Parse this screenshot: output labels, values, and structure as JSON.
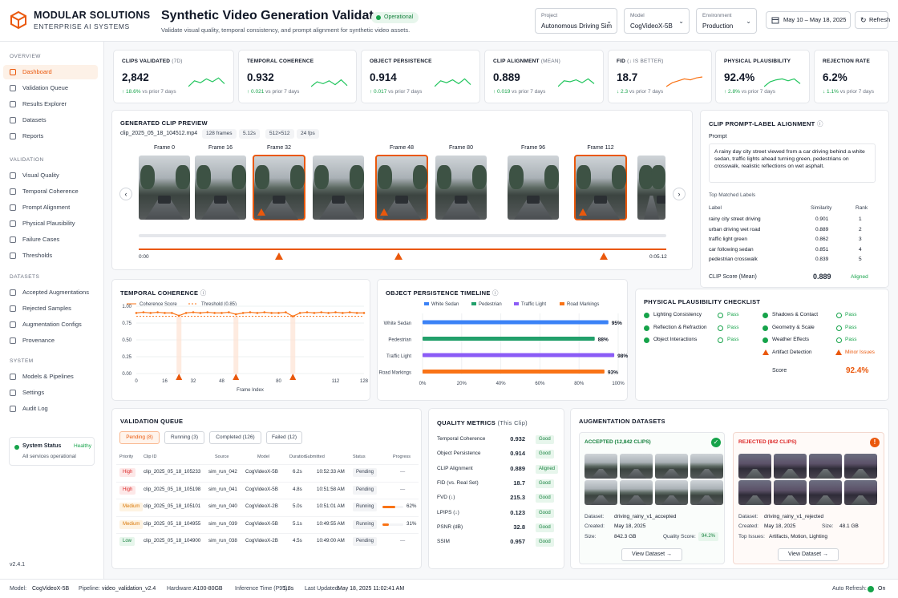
{
  "brand": {
    "name": "MODULAR SOLUTIONS",
    "tagline": "ENTERPRISE AI SYSTEMS"
  },
  "page": {
    "title": "Synthetic Video Generation Validator",
    "subtitle": "Validate visual quality, temporal consistency, and prompt alignment for synthetic video assets.",
    "status": "Operational"
  },
  "filters": {
    "project": {
      "label": "Project",
      "value": "Autonomous Driving Sim"
    },
    "model": {
      "label": "Model",
      "value": "CogVideoX-5B"
    },
    "environment": {
      "label": "Environment",
      "value": "Production"
    },
    "date_range": "May 10 – May 18, 2025",
    "refresh": "Refresh"
  },
  "sidebar": {
    "sections": [
      "OVERVIEW",
      "VALIDATION",
      "DATASETS",
      "SYSTEM"
    ],
    "overview": [
      "Dashboard",
      "Validation Queue",
      "Results Explorer",
      "Datasets",
      "Reports"
    ],
    "validation": [
      "Visual Quality",
      "Temporal Coherence",
      "Prompt Alignment",
      "Physical Plausibility",
      "Failure Cases",
      "Thresholds"
    ],
    "datasets": [
      "Accepted Augmentations",
      "Rejected Samples",
      "Augmentation Configs",
      "Provenance"
    ],
    "system": [
      "Models & Pipelines",
      "Settings",
      "Audit Log"
    ],
    "status": {
      "label": "System Status",
      "value": "Healthy",
      "detail": "All services operational"
    },
    "version": "v2.4.1"
  },
  "kpis": [
    {
      "label": "CLIPS VALIDATED",
      "sub": "(7D)",
      "value": "2,842",
      "delta": "↑ 18.6%",
      "note": "vs prior 7 days"
    },
    {
      "label": "TEMPORAL COHERENCE",
      "sub": "",
      "value": "0.932",
      "delta": "↑ 0.021",
      "note": "vs prior 7 days"
    },
    {
      "label": "OBJECT PERSISTENCE",
      "sub": "",
      "value": "0.914",
      "delta": "↑ 0.017",
      "note": "vs prior 7 days"
    },
    {
      "label": "CLIP ALIGNMENT",
      "sub": "(MEAN)",
      "value": "0.889",
      "delta": "↑ 0.019",
      "note": "vs prior 7 days"
    },
    {
      "label": "FID",
      "sub": "(↓ IS BETTER)",
      "value": "18.7",
      "delta": "↓ 2.3",
      "note": "vs prior 7 days"
    },
    {
      "label": "PHYSICAL PLAUSIBILITY",
      "sub": "",
      "value": "92.4%",
      "delta": "↑ 2.8%",
      "note": "vs prior 7 days"
    },
    {
      "label": "REJECTION RATE",
      "sub": "",
      "value": "6.2%",
      "delta": "↓ 1.1%",
      "note": "vs prior 7 days"
    }
  ],
  "preview": {
    "title": "GENERATED CLIP PREVIEW",
    "file": "clip_2025_05_18_104512.mp4",
    "tags": [
      "128 frames",
      "5.12s",
      "512×512",
      "24 fps"
    ],
    "frames": [
      "Frame 0",
      "Frame 16",
      "Frame 32",
      "",
      "Frame 48",
      "Frame 80",
      "Frame 96",
      "Frame 112"
    ],
    "start": "0:00",
    "end": "0:05.12"
  },
  "clip_align": {
    "title": "CLIP PROMPT-LABEL ALIGNMENT",
    "prompt_label": "Prompt",
    "prompt": "A rainy day city street viewed from a car driving behind a white sedan, traffic lights ahead turning green, pedestrians on crosswalk, realistic reflections on wet asphalt.",
    "top_label": "Top Matched Labels",
    "cols": [
      "Label",
      "Similarity",
      "Rank"
    ],
    "rows": [
      [
        "rainy city street driving",
        "0.901",
        "1"
      ],
      [
        "urban driving wet road",
        "0.889",
        "2"
      ],
      [
        "traffic light green",
        "0.862",
        "3"
      ],
      [
        "car following sedan",
        "0.851",
        "4"
      ],
      [
        "pedestrian crosswalk",
        "0.839",
        "5"
      ]
    ],
    "score_label": "CLIP Score (Mean)",
    "score": "0.889",
    "verdict": "Aligned"
  },
  "temporal": {
    "title": "TEMPORAL COHERENCE",
    "legend": [
      "Coherence Score",
      "Threshold (0.85)"
    ],
    "xlabel": "Frame Index"
  },
  "persistence": {
    "title": "OBJECT PERSISTENCE TIMELINE",
    "legend": [
      "White Sedan",
      "Pedestrian",
      "Traffic Light",
      "Road Markings"
    ]
  },
  "physical": {
    "title": "PHYSICAL PLAUSIBILITY CHECKLIST",
    "left": [
      [
        "Lighting Consistency",
        "Pass"
      ],
      [
        "Reflection & Refraction",
        "Pass"
      ],
      [
        "Object Interactions",
        "Pass"
      ]
    ],
    "right": [
      [
        "Shadows & Contact",
        "Pass"
      ],
      [
        "Geometry & Scale",
        "Pass"
      ],
      [
        "Weather Effects",
        "Pass"
      ],
      [
        "Artifact Detection",
        "Minor Issues"
      ]
    ],
    "score_label": "Score",
    "score": "92.4%"
  },
  "queue": {
    "title": "VALIDATION QUEUE",
    "tabs": [
      "Pending (8)",
      "Running (3)",
      "Completed (126)",
      "Failed (12)"
    ],
    "cols": [
      "Priority",
      "Clip ID",
      "Source",
      "Model",
      "Duration",
      "Submitted",
      "Status",
      "Progress"
    ],
    "rows": [
      [
        "High",
        "clip_2025_05_18_105233",
        "sim_run_042",
        "CogVideoX-5B",
        "6.2s",
        "10:52:33 AM",
        "Pending",
        "—"
      ],
      [
        "High",
        "clip_2025_05_18_105198",
        "sim_run_041",
        "CogVideoX-5B",
        "4.8s",
        "10:51:58 AM",
        "Pending",
        "—"
      ],
      [
        "Medium",
        "clip_2025_05_18_105101",
        "sim_run_040",
        "CogVideoX-2B",
        "5.0s",
        "10:51:01 AM",
        "Running",
        "62%"
      ],
      [
        "Medium",
        "clip_2025_05_18_104955",
        "sim_run_039",
        "CogVideoX-5B",
        "5.1s",
        "10:49:55 AM",
        "Running",
        "31%"
      ],
      [
        "Low",
        "clip_2025_05_18_104900",
        "sim_run_038",
        "CogVideoX-2B",
        "4.5s",
        "10:49:00 AM",
        "Pending",
        "—"
      ]
    ]
  },
  "quality": {
    "title": "QUALITY METRICS",
    "sub": "(This Clip)",
    "rows": [
      [
        "Temporal Coherence",
        "0.932",
        "Good"
      ],
      [
        "Object Persistence",
        "0.914",
        "Good"
      ],
      [
        "CLIP Alignment",
        "0.889",
        "Aligned"
      ],
      [
        "FID (vs. Real Set)",
        "18.7",
        "Good"
      ],
      [
        "FVD (↓)",
        "215.3",
        "Good"
      ],
      [
        "LPIPS (↓)",
        "0.123",
        "Good"
      ],
      [
        "PSNR (dB)",
        "32.8",
        "Good"
      ],
      [
        "SSIM",
        "0.957",
        "Good"
      ]
    ]
  },
  "aug": {
    "title": "AUGMENTATION DATASETS",
    "accepted": {
      "head": "ACCEPTED (12,842 CLIPS)",
      "dataset": "driving_rainy_v1_accepted",
      "created": "May 18, 2025",
      "size": "842.3 GB",
      "qs_label": "Quality Score:",
      "qs": "94.2%",
      "btn": "View Dataset"
    },
    "rejected": {
      "head": "REJECTED (842 CLIPS)",
      "dataset": "driving_rainy_v1_rejected",
      "created": "May 18, 2025",
      "size": "48.1 GB",
      "issues": "Artifacts, Motion, Lighting",
      "btn": "View Dataset"
    },
    "labels": {
      "dataset": "Dataset:",
      "created": "Created:",
      "size": "Size:",
      "issues": "Top Issues:"
    }
  },
  "footer": {
    "model": "Model:",
    "model_v": "CogVideoX-5B",
    "pipe": "Pipeline:",
    "pipe_v": "video_validation_v2.4",
    "hw": "Hardware:",
    "hw_v": "A100-80GB",
    "inf": "Inference Time (P95):",
    "inf_v": "1.8s",
    "upd": "Last Updated:",
    "upd_v": "May 18, 2025 11:02:41 AM",
    "auto": "Auto Refresh:",
    "auto_v": "On"
  },
  "chart_data": [
    {
      "type": "line",
      "title": "TEMPORAL COHERENCE",
      "x": [
        0,
        4,
        8,
        12,
        16,
        20,
        24,
        28,
        32,
        36,
        40,
        44,
        48,
        52,
        56,
        60,
        64,
        68,
        72,
        76,
        80,
        84,
        88,
        92,
        96,
        100,
        104,
        108,
        112,
        116,
        120,
        124,
        128
      ],
      "y": [
        0.9,
        0.91,
        0.9,
        0.91,
        0.9,
        0.9,
        0.86,
        0.9,
        0.91,
        0.9,
        0.91,
        0.9,
        0.9,
        0.91,
        0.88,
        0.9,
        0.91,
        0.9,
        0.91,
        0.9,
        0.9,
        0.91,
        0.85,
        0.9,
        0.91,
        0.9,
        0.91,
        0.9,
        0.91,
        0.9,
        0.91,
        0.9,
        0.9
      ],
      "threshold": 0.85,
      "xlabel": "Frame Index",
      "ylim": [
        0,
        1
      ],
      "yticks": [
        0,
        0.25,
        0.5,
        0.75,
        1.0
      ],
      "xticks": [
        0,
        16,
        32,
        48,
        80,
        112,
        128
      ]
    },
    {
      "type": "bar",
      "title": "OBJECT PERSISTENCE TIMELINE",
      "categories": [
        "White Sedan",
        "Pedestrian",
        "Traffic Light",
        "Road Markings"
      ],
      "values": [
        95,
        88,
        98,
        93
      ],
      "colors": [
        "#3b82f6",
        "#22a06b",
        "#8b5cf6",
        "#f97316"
      ],
      "xlim": [
        0,
        100
      ],
      "xticks": [
        "0%",
        "20%",
        "40%",
        "60%",
        "80%",
        "100%"
      ]
    }
  ]
}
